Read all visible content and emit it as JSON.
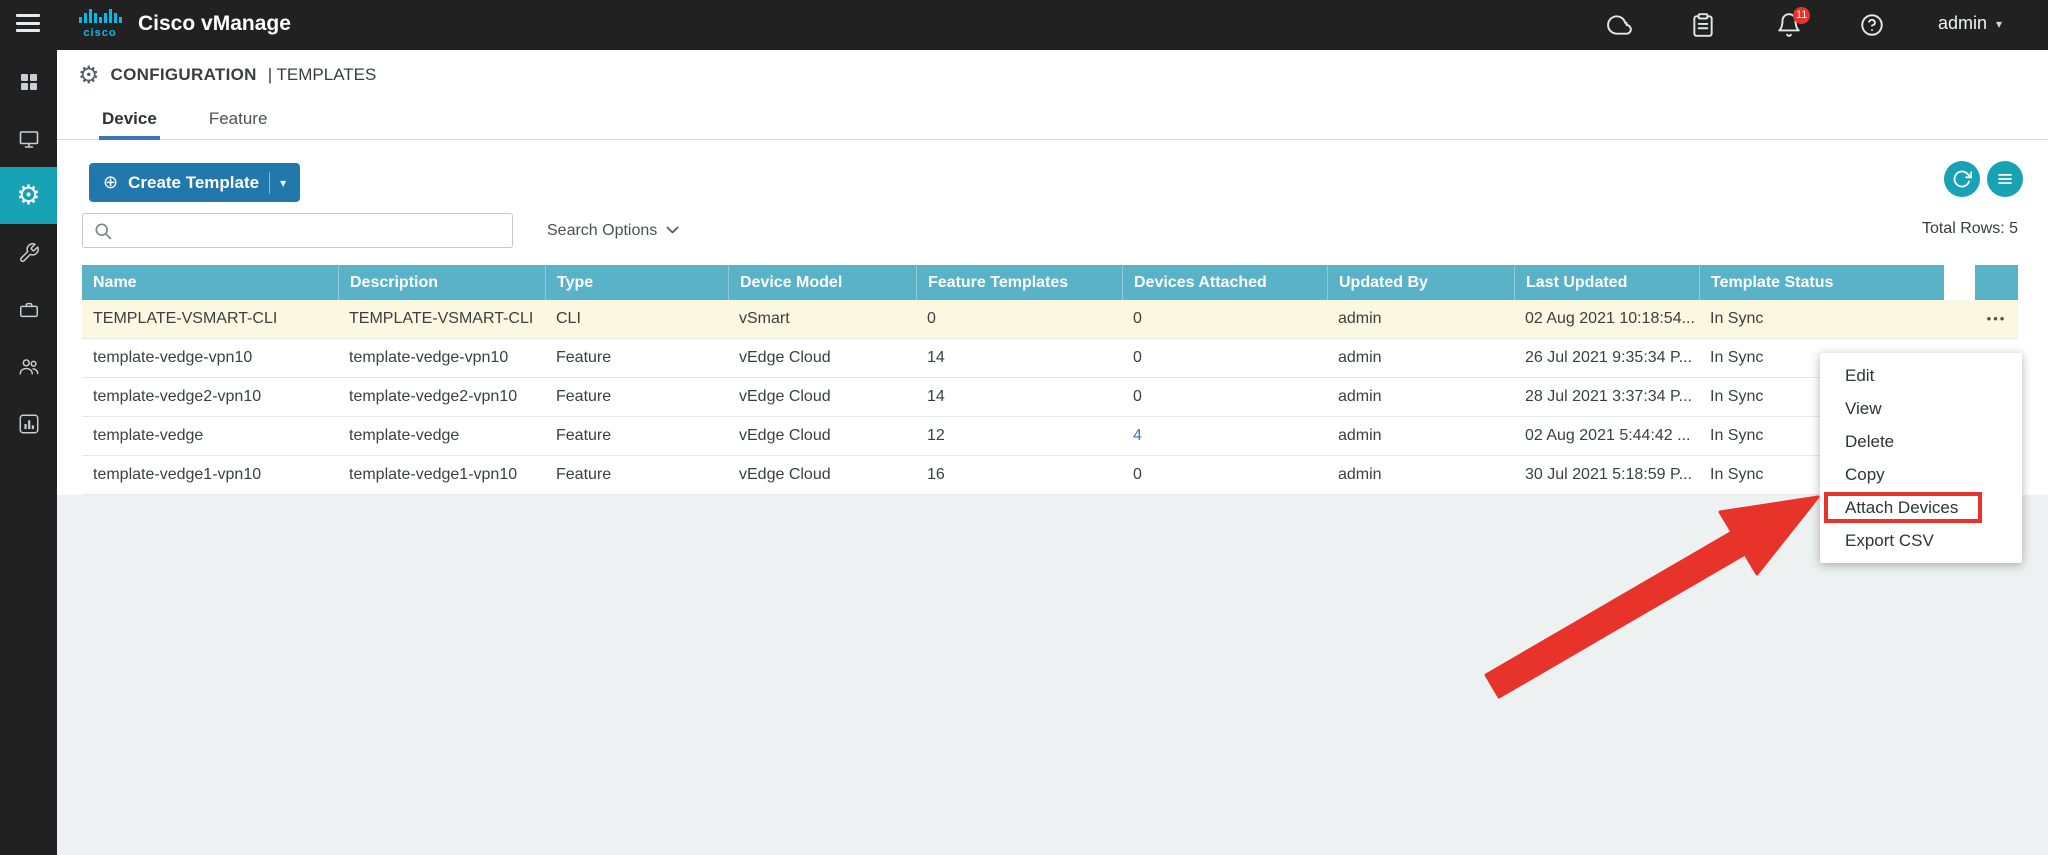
{
  "colors": {
    "topbar_bg": "#212121",
    "accent_teal": "#18a2b6",
    "table_header_bg": "#5ab2c8",
    "create_button_bg": "#2277ad",
    "link_blue": "#2b7cc2",
    "row_highlight_bg": "#fbf7e0",
    "callout_red": "#e8332a",
    "cisco_logo_blue": "#00bceb"
  },
  "icons": {
    "gear": "⚙",
    "circled_plus": "⊕",
    "caret_down": "▾",
    "more": "•••"
  },
  "topbar": {
    "brand": "Cisco vManage",
    "logo_text": "cisco",
    "notification_badge": "11",
    "user_label": "admin"
  },
  "page": {
    "title_primary": "CONFIGURATION",
    "title_secondary": "| TEMPLATES",
    "tabs": {
      "device": "Device",
      "feature": "Feature"
    },
    "create_button_label": "Create Template",
    "search": {
      "value": "",
      "placeholder": ""
    },
    "search_options_label": "Search Options",
    "total_rows_label": "Total Rows: 5"
  },
  "table": {
    "columns": [
      "Name",
      "Description",
      "Type",
      "Device Model",
      "Feature Templates",
      "Devices Attached",
      "Updated By",
      "Last Updated",
      "Template Status"
    ],
    "rows": [
      {
        "name": "TEMPLATE-VSMART-CLI",
        "description": "TEMPLATE-VSMART-CLI",
        "type": "CLI",
        "device_model": "vSmart",
        "feature_templates": "0",
        "devices_attached": "0",
        "updated_by": "admin",
        "last_updated": "02 Aug 2021 10:18:54...",
        "template_status": "In Sync"
      },
      {
        "name": "template-vedge-vpn10",
        "description": "template-vedge-vpn10",
        "type": "Feature",
        "device_model": "vEdge Cloud",
        "feature_templates": "14",
        "devices_attached": "0",
        "updated_by": "admin",
        "last_updated": "26 Jul 2021 9:35:34 P...",
        "template_status": "In Sync"
      },
      {
        "name": "template-vedge2-vpn10",
        "description": "template-vedge2-vpn10",
        "type": "Feature",
        "device_model": "vEdge Cloud",
        "feature_templates": "14",
        "devices_attached": "0",
        "updated_by": "admin",
        "last_updated": "28 Jul 2021 3:37:34 P...",
        "template_status": "In Sync"
      },
      {
        "name": "template-vedge",
        "description": "template-vedge",
        "type": "Feature",
        "device_model": "vEdge Cloud",
        "feature_templates": "12",
        "devices_attached": "4",
        "updated_by": "admin",
        "last_updated": "02 Aug 2021 5:44:42 ...",
        "template_status": "In Sync"
      },
      {
        "name": "template-vedge1-vpn10",
        "description": "template-vedge1-vpn10",
        "type": "Feature",
        "device_model": "vEdge Cloud",
        "feature_templates": "16",
        "devices_attached": "0",
        "updated_by": "admin",
        "last_updated": "30 Jul 2021 5:18:59 P...",
        "template_status": "In Sync"
      }
    ]
  },
  "context_menu": {
    "items": [
      "Edit",
      "View",
      "Delete",
      "Copy",
      "Attach Devices",
      "Export CSV"
    ],
    "highlighted_item": "Attach Devices"
  }
}
